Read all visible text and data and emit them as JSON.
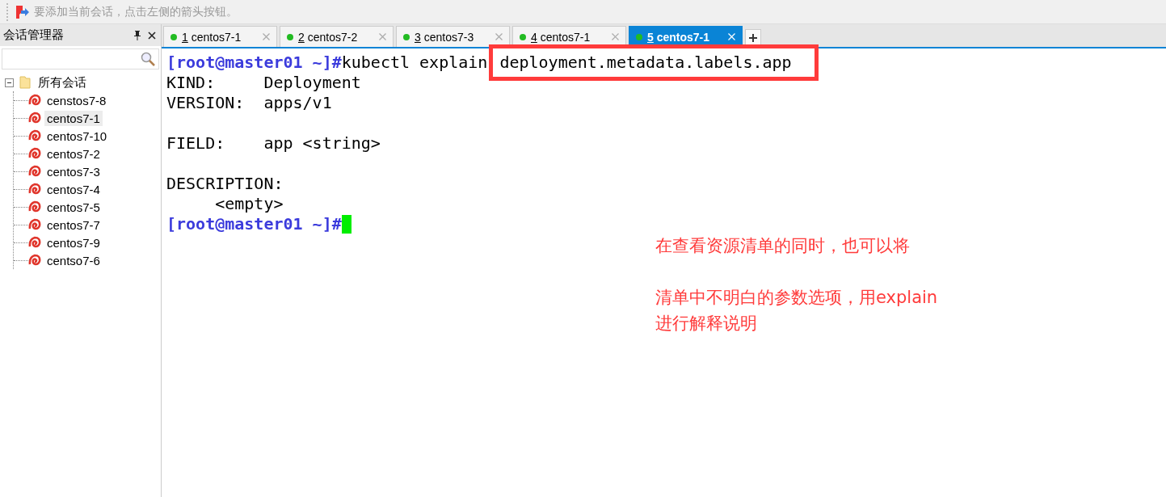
{
  "toolbar": {
    "hint": "要添加当前会话，点击左侧的箭头按钮。"
  },
  "session_manager": {
    "title": "会话管理器",
    "tree": [
      {
        "label": "所有会话",
        "expanded": true,
        "selected": false,
        "children": [
          {
            "label": "censtos7-8",
            "selected": false
          },
          {
            "label": "centos7-1",
            "selected": true
          },
          {
            "label": "centos7-10",
            "selected": false
          },
          {
            "label": "centos7-2",
            "selected": false
          },
          {
            "label": "centos7-3",
            "selected": false
          },
          {
            "label": "centos7-4",
            "selected": false
          },
          {
            "label": "centos7-5",
            "selected": false
          },
          {
            "label": "centos7-7",
            "selected": false
          },
          {
            "label": "centos7-9",
            "selected": false
          },
          {
            "label": "centso7-6",
            "selected": false
          }
        ]
      }
    ]
  },
  "tabs": [
    {
      "number": "1",
      "label": "centos7-1",
      "selected": false
    },
    {
      "number": "2",
      "label": "centos7-2",
      "selected": false
    },
    {
      "number": "3",
      "label": "centos7-3",
      "selected": false
    },
    {
      "number": "4",
      "label": "centos7-1",
      "selected": false
    },
    {
      "number": "5",
      "label": "centos7-1",
      "selected": true
    }
  ],
  "terminal": {
    "lines": [
      {
        "kind": "prompt",
        "prompt": "[root@master01 ~]#",
        "command": "kubectl explain ",
        "highlight": "deployment.metadata.labels.app"
      },
      {
        "kind": "output",
        "text": "KIND:     Deployment"
      },
      {
        "kind": "output",
        "text": "VERSION:  apps/v1"
      },
      {
        "kind": "blank"
      },
      {
        "kind": "output",
        "text": "FIELD:    app <string>"
      },
      {
        "kind": "blank"
      },
      {
        "kind": "output",
        "text": "DESCRIPTION:"
      },
      {
        "kind": "output",
        "text": "     <empty>"
      },
      {
        "kind": "prompt",
        "prompt": "[root@master01 ~]#",
        "cursor": true
      }
    ]
  },
  "annotation": {
    "paragraphs": [
      "在查看资源清单的同时，也可以将",
      "清单中不明白的参数选项，用explain\n进行解释说明"
    ]
  }
}
